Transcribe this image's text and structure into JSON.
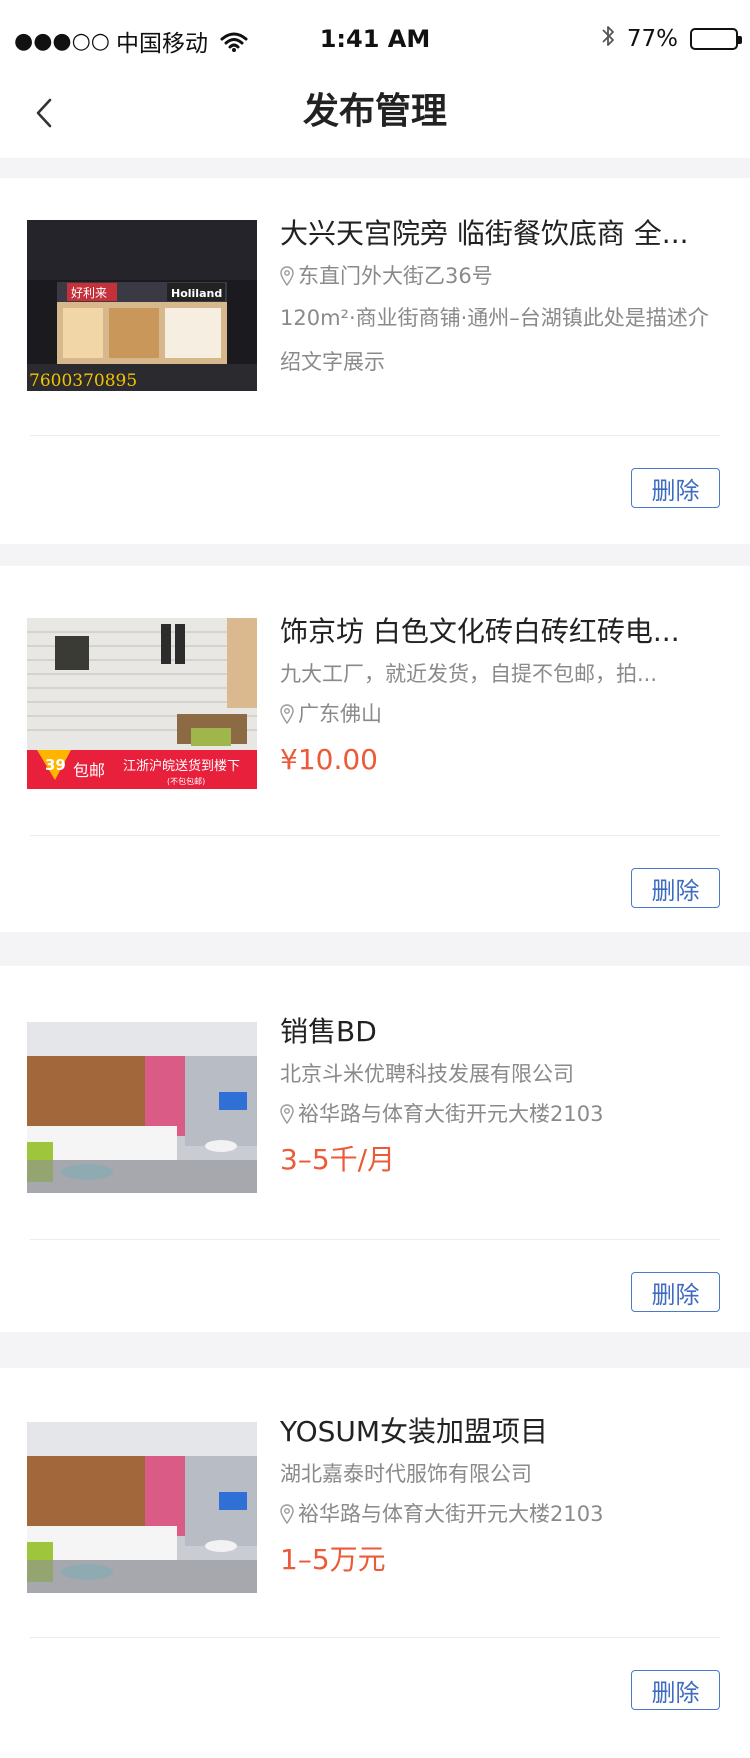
{
  "status_bar": {
    "signal": "●●●○○",
    "carrier": "中国移动",
    "time": "1:41 AM",
    "bluetooth_icon": "bluetooth-icon",
    "battery_text": "77%",
    "battery_level": 0.77
  },
  "nav": {
    "title": "发布管理",
    "back_icon": "chevron-left-icon"
  },
  "items": [
    {
      "title": "大兴天宫院旁 临街餐饮底商 全...",
      "location": "东直门外大街乙36号",
      "description": "120m²·商业街商铺·通州–台湖镇此处是描述介绍文字展示",
      "image_caption": "7600370895",
      "delete_label": "删除"
    },
    {
      "title": "饰京坊 白色文化砖白砖红砖电...",
      "subtitle": "九大工厂，就近发货，自提不包邮，拍...",
      "location": "广东佛山",
      "price": "¥10.00",
      "image_banner": "江浙沪皖送货到楼下",
      "image_banner_sub": "(不包包邮)",
      "image_badge": "39",
      "image_badge_text": "包邮",
      "delete_label": "删除"
    },
    {
      "title": "销售BD",
      "company": "北京斗米优聘科技发展有限公司",
      "location": "裕华路与体育大街开元大楼2103",
      "price": "3–5千/月",
      "delete_label": "删除"
    },
    {
      "title": "YOSUM女装加盟项目",
      "company": "湖北嘉泰时代服饰有限公司",
      "location": "裕华路与体育大街开元大楼2103",
      "price": "1–5万元",
      "delete_label": "删除"
    }
  ],
  "colors": {
    "accent_price": "#ec5a37",
    "button_border": "#4b79c9",
    "background": "#f4f4f6"
  }
}
